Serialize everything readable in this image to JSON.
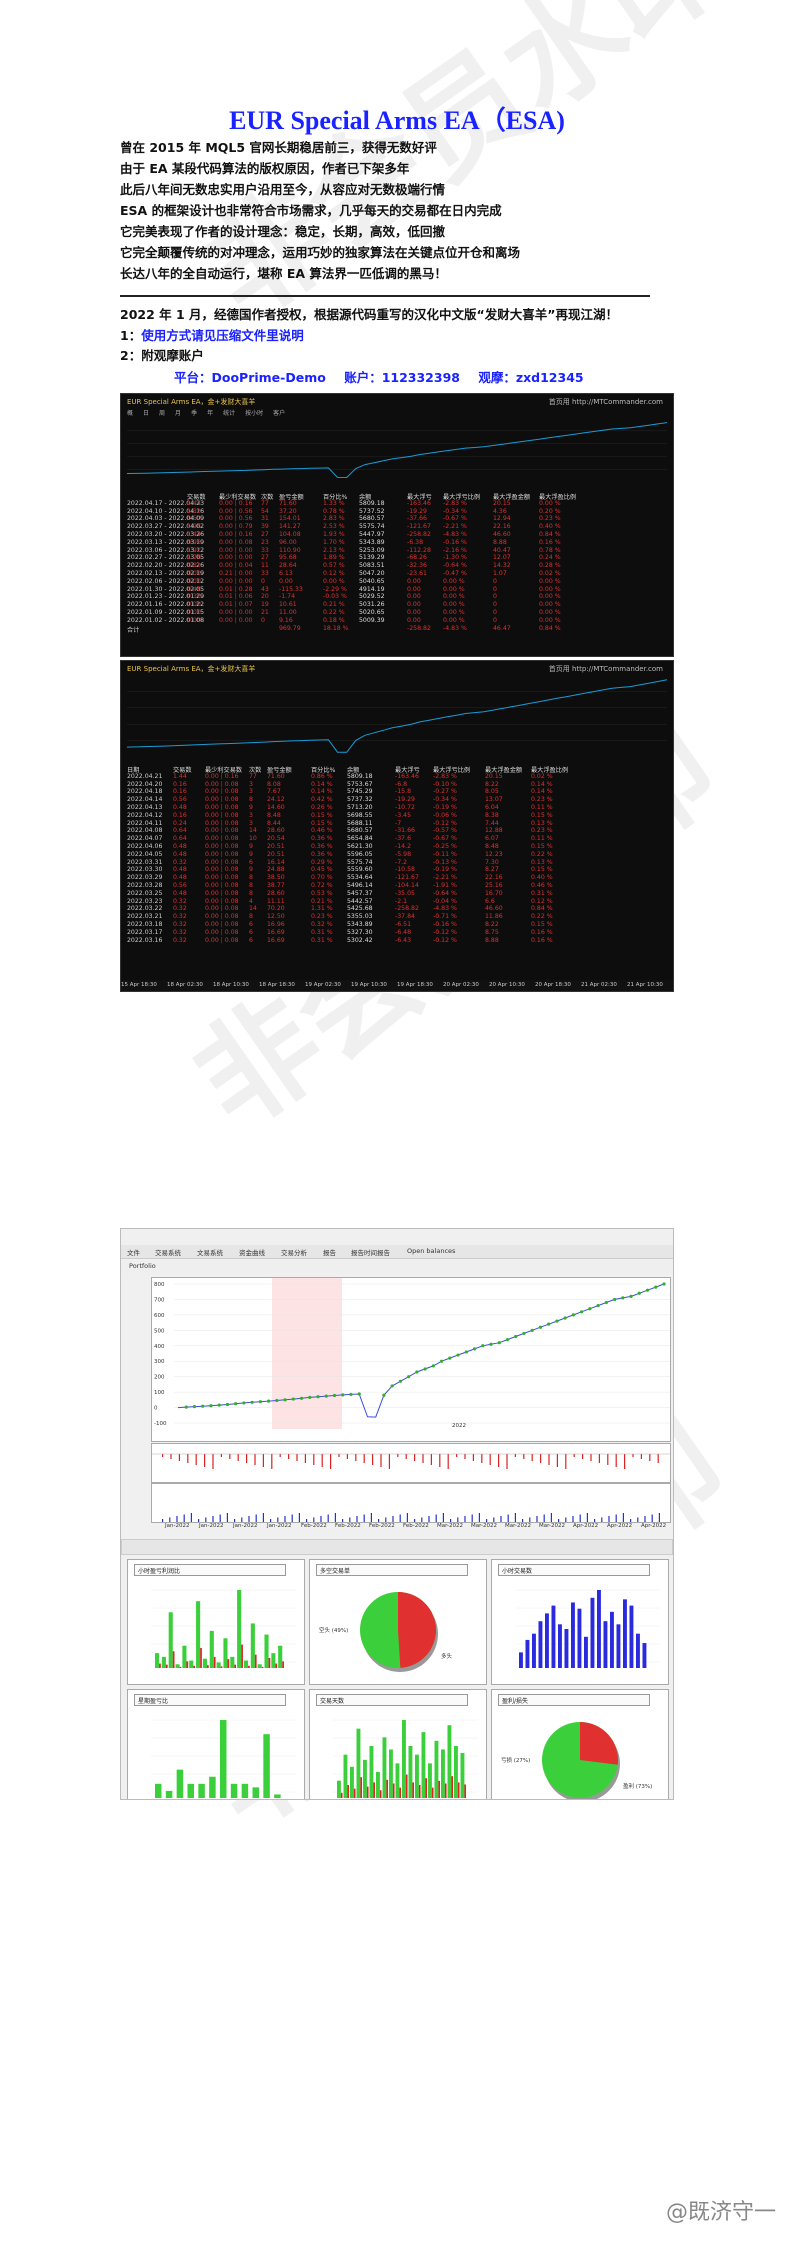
{
  "title": "EUR Special Arms EA（ESA)",
  "intro": [
    "曾在 2015 年 MQL5 官网长期稳居前三，获得无数好评",
    "由于 EA 某段代码算法的版权原因，作者已下架多年",
    "此后八年间无数忠实用户沿用至今，从容应对无数极端行情",
    "ESA 的框架设计也非常符合市场需求，几乎每天的交易都在日内完成",
    "它完美表现了作者的设计理念：稳定，长期，高效，低回撤",
    "它完全颠覆传统的对冲理念，运用巧妙的独家算法在关键点位开仓和离场",
    "长达八年的全自动运行，堪称 EA 算法界一匹低调的黑马！"
  ],
  "authorization": "2022 年 1 月，经德国作者授权，根据源代码重写的汉化中文版“发财大喜羊”再现江湖！",
  "item1_prefix": "1：",
  "item1_link": "使用方式请见压缩文件里说明",
  "item2": "2：附观摩账户",
  "account": {
    "platform": "平台：DooPrime-Demo",
    "account": "账户：112332398",
    "password": "观摩：zxd12345"
  },
  "panel1": {
    "title": "EUR Special Arms EA，金+发财大喜羊",
    "url": "首页用 http://MTCommander.com",
    "tabs": [
      "概",
      "日",
      "周",
      "月",
      "季",
      "年",
      "统计",
      "按小时",
      "客户"
    ],
    "header": [
      "",
      "交易数",
      "最少利交易数",
      "次数",
      "盈亏金额",
      "",
      "百分比%",
      "余额",
      "最大浮亏",
      "最大浮亏比例",
      "最大浮盈金额",
      "最大浮盈比例"
    ],
    "rows": [
      [
        "2022.04.17 - 2022.04.23",
        "1.44",
        "0.00 | 0.16",
        "77",
        "71.60",
        "1.33 %",
        "5809.18",
        "-163.46",
        "-2.83 %",
        "20.15",
        "0.00 %"
      ],
      [
        "2022.04.10 - 2022.04.16",
        "1.32",
        "0.00 | 0.56",
        "54",
        "37.20",
        "0.78 %",
        "5737.52",
        "-19.29",
        "-0.34 %",
        "4.36",
        "0.20 %"
      ],
      [
        "2022.04.03 - 2022.04.09",
        "0.50",
        "0.00 | 0.56",
        "31",
        "154.01",
        "2.83 %",
        "5680.57",
        "-37.66",
        "-0.67 %",
        "12.94",
        "0.23 %"
      ],
      [
        "2022.03.27 - 2022.04.02",
        "1.96",
        "0.00 | 0.79",
        "39",
        "141.27",
        "2.53 %",
        "5575.74",
        "-121.67",
        "-2.21 %",
        "22.16",
        "0.40 %"
      ],
      [
        "2022.03.20 - 2022.03.26",
        "1.44",
        "0.00 | 0.16",
        "27",
        "104.08",
        "1.93 %",
        "5447.97",
        "-258.82",
        "-4.83 %",
        "46.60",
        "0.84 %"
      ],
      [
        "2022.03.13 - 2022.03.19",
        "0.96",
        "0.00 | 0.08",
        "23",
        "96.00",
        "1.70 %",
        "5343.89",
        "-6.38",
        "-0.16 %",
        "8.88",
        "0.16 %"
      ],
      [
        "2022.03.06 - 2022.03.12",
        "1.92",
        "0.00 | 0.00",
        "33",
        "110.90",
        "2.13 %",
        "5253.09",
        "-112.28",
        "-2.16 %",
        "40.47",
        "0.78 %"
      ],
      [
        "2022.02.27 - 2022.03.05",
        "1.76",
        "0.00 | 0.00",
        "27",
        "95.68",
        "1.89 %",
        "5139.29",
        "-68.26",
        "-1.30 %",
        "12.07",
        "0.24 %"
      ],
      [
        "2022.02.20 - 2022.02.26",
        "0.81",
        "0.00 | 0.04",
        "11",
        "28.64",
        "0.57 %",
        "5083.51",
        "-32.36",
        "-0.64 %",
        "14.32",
        "0.28 %"
      ],
      [
        "2022.02.13 - 2022.02.19",
        "0.00",
        "0.21 | 0.00",
        "33",
        "6.13",
        "0.12 %",
        "5047.20",
        "-23.61",
        "-0.47 %",
        "1.07",
        "0.02 %"
      ],
      [
        "2022.02.06 - 2022.02.12",
        "0.00",
        "0.00 | 0.00",
        "0",
        "0.00",
        "0.00 %",
        "5040.65",
        "0.00",
        "0.00 %",
        "0",
        "0.00 %"
      ],
      [
        "2022.01.30 - 2022.02.05",
        "0.48",
        "0.01 | 0.28",
        "43",
        "-115.33",
        "-2.29 %",
        "4914.19",
        "0.00",
        "0.00 %",
        "0",
        "0.00 %"
      ],
      [
        "2022.01.23 - 2022.01.29",
        "0.36",
        "0.01 | 0.06",
        "20",
        "-1.74",
        "-0.03 %",
        "5029.52",
        "0.00",
        "0.00 %",
        "0",
        "0.00 %"
      ],
      [
        "2022.01.16 - 2022.01.22",
        "0.00",
        "0.01 | 0.07",
        "19",
        "10.61",
        "0.21 %",
        "5031.26",
        "0.00",
        "0.00 %",
        "0",
        "0.00 %"
      ],
      [
        "2022.01.09 - 2022.01.15",
        "0.00",
        "0.00 | 0.00",
        "21",
        "11.00",
        "0.22 %",
        "5020.65",
        "0.00",
        "0.00 %",
        "0",
        "0.00 %"
      ],
      [
        "2022.01.02 - 2022.01.08",
        "0.00",
        "0.00 | 0.00",
        "0",
        "9.16",
        "0.18 %",
        "5009.39",
        "0.00",
        "0.00 %",
        "0",
        "0.00 %"
      ],
      [
        "合计",
        "",
        "",
        "",
        "969.79",
        "18.18 %",
        "",
        "-258.82",
        "-4.83 %",
        "46.47",
        "0.84 %"
      ]
    ]
  },
  "panel2": {
    "title": "EUR Special Arms EA，金+发财大喜羊",
    "url": "首页用 http://MTCommander.com",
    "header": [
      "日期",
      "交易数",
      "最少利交易数",
      "次数",
      "盈亏金额",
      "百分比%",
      "余额",
      "最大浮亏",
      "最大浮亏比例",
      "最大浮盈金额",
      "最大浮盈比例"
    ],
    "rows": [
      [
        "2022.04.21",
        "1.44",
        "0.00 | 0.16",
        "77",
        "71.60",
        "0.86 %",
        "5809.18",
        "-163.46",
        "-2.83 %",
        "20.15",
        "0.02 %"
      ],
      [
        "2022.04.20",
        "0.16",
        "0.00 | 0.08",
        "3",
        "8.08",
        "0.14 %",
        "5753.67",
        "-6.8",
        "-0.10 %",
        "8.22",
        "0.14 %"
      ],
      [
        "2022.04.18",
        "0.16",
        "0.00 | 0.08",
        "3",
        "7.67",
        "0.14 %",
        "5745.29",
        "-15.8",
        "-0.27 %",
        "8.05",
        "0.14 %"
      ],
      [
        "2022.04.14",
        "0.56",
        "0.00 | 0.08",
        "8",
        "24.12",
        "0.42 %",
        "5737.32",
        "-19.29",
        "-0.34 %",
        "13.07",
        "0.23 %"
      ],
      [
        "2022.04.13",
        "0.48",
        "0.00 | 0.08",
        "9",
        "14.60",
        "0.26 %",
        "5713.20",
        "-10.72",
        "-0.19 %",
        "6.04",
        "0.11 %"
      ],
      [
        "2022.04.12",
        "0.16",
        "0.00 | 0.08",
        "3",
        "8.48",
        "0.15 %",
        "5698.55",
        "-3.45",
        "-0.06 %",
        "8.38",
        "0.15 %"
      ],
      [
        "2022.04.11",
        "0.24",
        "0.00 | 0.08",
        "3",
        "8.44",
        "0.15 %",
        "5688.11",
        "-7",
        "-0.12 %",
        "7.44",
        "0.13 %"
      ],
      [
        "2022.04.08",
        "0.64",
        "0.00 | 0.08",
        "14",
        "28.60",
        "0.46 %",
        "5680.57",
        "-31.66",
        "-0.57 %",
        "12.88",
        "0.23 %"
      ],
      [
        "2022.04.07",
        "0.64",
        "0.00 | 0.08",
        "10",
        "20.54",
        "0.36 %",
        "5654.84",
        "-37.6",
        "-0.67 %",
        "6.07",
        "0.11 %"
      ],
      [
        "2022.04.06",
        "0.48",
        "0.00 | 0.08",
        "9",
        "20.51",
        "0.36 %",
        "5621.30",
        "-14.2",
        "-0.25 %",
        "8.48",
        "0.15 %"
      ],
      [
        "2022.04.05",
        "0.48",
        "0.00 | 0.08",
        "9",
        "20.51",
        "0.36 %",
        "5596.05",
        "-5.98",
        "-0.11 %",
        "12.23",
        "0.22 %"
      ],
      [
        "2022.03.31",
        "0.32",
        "0.00 | 0.08",
        "6",
        "16.14",
        "0.29 %",
        "5575.74",
        "-7.2",
        "-0.13 %",
        "7.30",
        "0.13 %"
      ],
      [
        "2022.03.30",
        "0.48",
        "0.00 | 0.08",
        "9",
        "24.88",
        "0.45 %",
        "5559.60",
        "-10.58",
        "-0.19 %",
        "8.27",
        "0.15 %"
      ],
      [
        "2022.03.29",
        "0.48",
        "0.00 | 0.08",
        "8",
        "38.50",
        "0.70 %",
        "5534.64",
        "-121.67",
        "-2.21 %",
        "22.16",
        "0.40 %"
      ],
      [
        "2022.03.28",
        "0.56",
        "0.00 | 0.08",
        "8",
        "38.77",
        "0.72 %",
        "5496.14",
        "-104.14",
        "-1.91 %",
        "25.16",
        "0.46 %"
      ],
      [
        "2022.03.25",
        "0.48",
        "0.00 | 0.08",
        "8",
        "28.60",
        "0.53 %",
        "5457.37",
        "-35.05",
        "-0.64 %",
        "16.70",
        "0.31 %"
      ],
      [
        "2022.03.23",
        "0.32",
        "0.00 | 0.08",
        "4",
        "11.11",
        "0.21 %",
        "5442.57",
        "-2.1",
        "-0.04 %",
        "6.6",
        "0.12 %"
      ],
      [
        "2022.03.22",
        "0.32",
        "0.00 | 0.08",
        "14",
        "70.20",
        "1.31 %",
        "5425.68",
        "-258.82",
        "-4.83 %",
        "46.60",
        "0.84 %"
      ],
      [
        "2022.03.21",
        "0.32",
        "0.00 | 0.08",
        "8",
        "12.50",
        "0.23 %",
        "5355.03",
        "-37.84",
        "-0.71 %",
        "11.86",
        "0.22 %"
      ],
      [
        "2022.03.18",
        "0.32",
        "0.00 | 0.08",
        "6",
        "16.96",
        "0.32 %",
        "5343.89",
        "-6.51",
        "-0.16 %",
        "8.22",
        "0.15 %"
      ],
      [
        "2022.03.17",
        "0.32",
        "0.00 | 0.08",
        "6",
        "16.69",
        "0.31 %",
        "5327.30",
        "-6.48",
        "-0.12 %",
        "8.75",
        "0.16 %"
      ],
      [
        "2022.03.16",
        "0.32",
        "0.00 | 0.08",
        "6",
        "16.69",
        "0.31 %",
        "5302.42",
        "-6.43",
        "-0.12 %",
        "8.88",
        "0.16 %"
      ]
    ],
    "xlabels": [
      "15 Apr 18:30",
      "18 Apr 02:30",
      "18 Apr 10:30",
      "18 Apr 18:30",
      "19 Apr 02:30",
      "19 Apr 10:30",
      "19 Apr 18:30",
      "20 Apr 02:30",
      "20 Apr 10:30",
      "20 Apr 18:30",
      "21 Apr 02:30",
      "21 Apr 10:30"
    ]
  },
  "mt": {
    "menubar": [
      "文件",
      "交易系统",
      "文易系统",
      "资金曲线",
      "交易分析",
      "报告",
      "报告时间报告",
      "Open balances"
    ],
    "toolbar_label": "Portfolio",
    "yticks": [
      "800",
      "700",
      "600",
      "500",
      "400",
      "300",
      "200",
      "100",
      "0",
      "-100"
    ],
    "xlabels": [
      "Jan-2022",
      "Jan-2022",
      "Jan-2022",
      "Jan-2022",
      "Feb-2022",
      "Feb-2022",
      "Feb-2022",
      "Feb-2022",
      "Mar-2022",
      "Mar-2022",
      "Mar-2022",
      "Mar-2022",
      "Apr-2022",
      "Apr-2022",
      "Apr-2022"
    ],
    "chart_mid_label": "2022",
    "widgets": [
      {
        "select": "小时盈亏利润比",
        "type": "bar",
        "values": [
          40,
          30,
          150,
          10,
          60,
          20,
          180,
          25,
          100,
          15,
          80,
          30,
          210,
          20,
          120,
          10,
          90,
          40,
          60
        ]
      },
      {
        "select": "多空交易单",
        "type": "pie",
        "values": [
          49,
          51
        ],
        "labels": [
          "空头 (49%)",
          "多头"
        ]
      },
      {
        "select": "小时交易数",
        "type": "bar",
        "values": [
          10,
          18,
          22,
          30,
          35,
          40,
          28,
          25,
          42,
          38,
          20,
          45,
          50,
          30,
          36,
          28,
          44,
          40,
          22,
          16
        ]
      },
      {
        "select": "星期盈亏比",
        "type": "bar",
        "values": [
          20,
          10,
          40,
          20,
          20,
          30,
          110,
          20,
          20,
          15,
          90,
          5
        ]
      },
      {
        "select": "交易天数",
        "type": "bar",
        "values": [
          10,
          25,
          18,
          40,
          22,
          30,
          15,
          35,
          28,
          20,
          45,
          30,
          25,
          38,
          20,
          33,
          28,
          42,
          30,
          26
        ]
      },
      {
        "select": "盈利/损失",
        "type": "pie",
        "values": [
          27,
          73
        ],
        "labels": [
          "亏损 (27%)",
          "盈利 (73%)"
        ]
      }
    ],
    "equity": [
      0,
      3,
      6,
      9,
      12,
      16,
      20,
      25,
      30,
      34,
      38,
      42,
      46,
      50,
      55,
      60,
      66,
      70,
      74,
      78,
      82,
      85,
      88,
      -60,
      -62,
      80,
      140,
      170,
      200,
      230,
      250,
      270,
      300,
      320,
      340,
      360,
      380,
      400,
      410,
      420,
      440,
      460,
      480,
      500,
      520,
      540,
      560,
      580,
      600,
      620,
      640,
      660,
      680,
      700,
      710,
      720,
      740,
      760,
      780,
      800
    ]
  },
  "footer": "@既济守一",
  "watermark": "非会员水印",
  "colors": {
    "blue": "#1a22ff",
    "red": "#e03030",
    "green": "#37c837",
    "accent": "#1a9bd7"
  }
}
